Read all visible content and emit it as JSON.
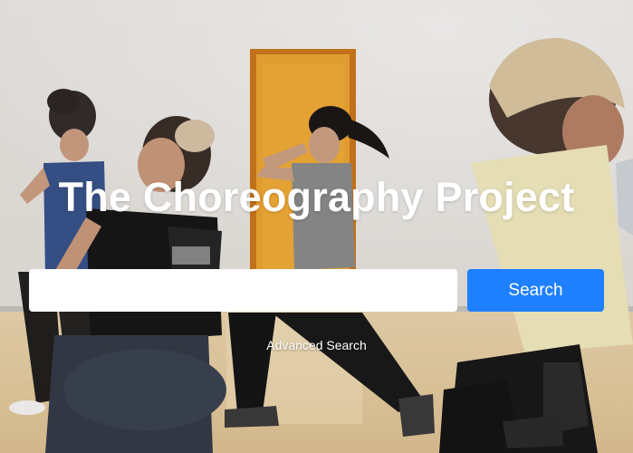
{
  "hero": {
    "title": "The Choreography Project"
  },
  "search": {
    "value": "",
    "placeholder": "",
    "button_label": "Search",
    "button_color": "#1e80ff"
  },
  "links": {
    "advanced_search": "Advanced Search"
  },
  "background": {
    "description_icon": "dance-photo",
    "wall_color": "#e9e6e2",
    "door_color": "#e89a2c",
    "floor_color": "#e6c99d"
  }
}
